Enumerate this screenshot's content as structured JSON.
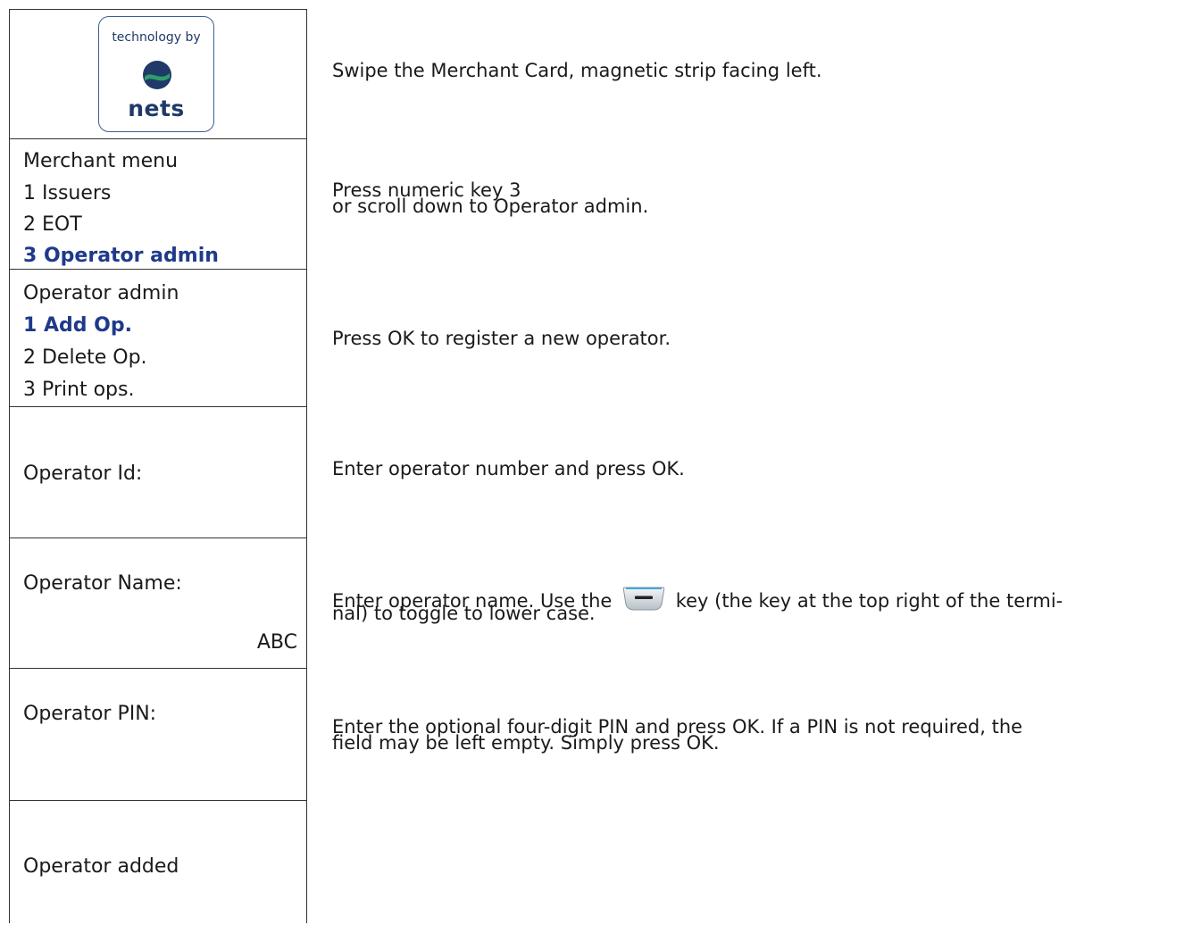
{
  "logo": {
    "top_text": "technology by",
    "brand": "nets"
  },
  "rows": [
    {
      "lines": []
    },
    {
      "lines": [
        {
          "text": "Merchant menu",
          "highlight": false
        },
        {
          "text": "1 Issuers",
          "highlight": false
        },
        {
          "text": "2 EOT",
          "highlight": false
        },
        {
          "text": "3 Operator admin",
          "highlight": true
        }
      ]
    },
    {
      "lines": [
        {
          "text": "Operator admin",
          "highlight": false
        },
        {
          "text": "1 Add Op.",
          "highlight": true
        },
        {
          "text": "2 Delete Op.",
          "highlight": false
        },
        {
          "text": "3 Print ops.",
          "highlight": false
        }
      ]
    },
    {
      "label": "Operator Id:"
    },
    {
      "label": "Operator Name:",
      "value": "ABC"
    },
    {
      "label": "Operator PIN:"
    },
    {
      "label": "Operator added"
    }
  ],
  "instructions": {
    "swipe": "Swipe the Merchant Card, magnetic strip facing left.",
    "numeric_1": "Press numeric key 3",
    "numeric_2": "or scroll down to Operator admin.",
    "ok_register": "Press OK to register a new operator.",
    "operator_number": "Enter operator number and press OK.",
    "name_1a": "Enter operator name. Use the",
    "name_1b": "key (the key at the top right of the termi-",
    "name_2": "nal) to toggle to lower case.",
    "pin_1": "Enter the optional four-digit PIN and press OK. If a PIN is not required, the",
    "pin_2": "field may be left empty. Simply press OK."
  },
  "icons": {
    "key_icon": "top-right-function-key-icon"
  },
  "colors": {
    "highlight": "#1f3a8a",
    "border": "#333333",
    "logo_blue": "#1f3a68",
    "logo_green": "#2e9e6a"
  }
}
